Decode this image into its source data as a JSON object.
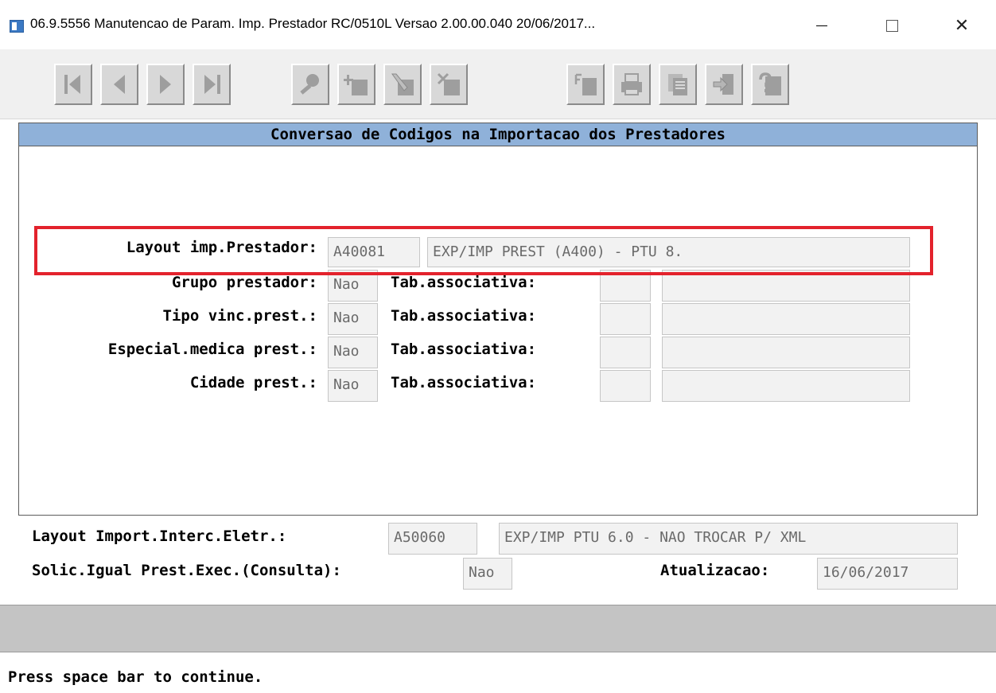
{
  "window": {
    "title": "06.9.5556 Manutencao  de Param. Imp. Prestador RC/0510L Versao 2.00.00.040 20/06/2017...",
    "close_glyph": "✕"
  },
  "toolbar": {
    "buttons": [
      {
        "name": "first-record",
        "icon": "first-icon"
      },
      {
        "name": "prev-record",
        "icon": "prev-icon"
      },
      {
        "name": "next-record",
        "icon": "next-icon"
      },
      {
        "name": "last-record",
        "icon": "last-icon"
      },
      {
        "name": "search",
        "icon": "search-icon"
      },
      {
        "name": "add",
        "icon": "add-icon"
      },
      {
        "name": "edit",
        "icon": "edit-icon"
      },
      {
        "name": "delete",
        "icon": "delete-icon"
      },
      {
        "name": "filter",
        "icon": "filter-icon"
      },
      {
        "name": "print",
        "icon": "print-icon"
      },
      {
        "name": "copy",
        "icon": "copy-icon"
      },
      {
        "name": "exit",
        "icon": "exit-icon"
      },
      {
        "name": "help",
        "icon": "help-icon"
      }
    ]
  },
  "frame": {
    "title": "Conversao de Codigos na Importacao dos Prestadores",
    "layout_label": "Layout imp.Prestador:",
    "layout_code": "A40081",
    "layout_desc": "EXP/IMP PREST (A400) - PTU 8.",
    "rows": [
      {
        "label": "Grupo prestador:",
        "value": "Nao",
        "assoc_label": "Tab.associativa:",
        "assoc_code": "",
        "assoc_desc": ""
      },
      {
        "label": "Tipo vinc.prest.:",
        "value": "Nao",
        "assoc_label": "Tab.associativa:",
        "assoc_code": "",
        "assoc_desc": ""
      },
      {
        "label": "Especial.medica prest.:",
        "value": "Nao",
        "assoc_label": "Tab.associativa:",
        "assoc_code": "",
        "assoc_desc": ""
      },
      {
        "label": "Cidade prest.:",
        "value": "Nao",
        "assoc_label": "Tab.associativa:",
        "assoc_code": "",
        "assoc_desc": ""
      }
    ]
  },
  "bottom": {
    "import_label": "Layout Import.Interc.Eletr.:",
    "import_code": "A50060",
    "import_desc": "EXP/IMP PTU 6.0 - NAO TROCAR P/ XML",
    "solic_label": "Solic.Igual Prest.Exec.(Consulta):",
    "solic_value": "Nao",
    "atual_label": "Atualizacao:",
    "atual_value": "16/06/2017"
  },
  "status": "Press space bar to continue.",
  "colors": {
    "frame_header": "#8fb1d9",
    "highlight": "#e3222c"
  }
}
